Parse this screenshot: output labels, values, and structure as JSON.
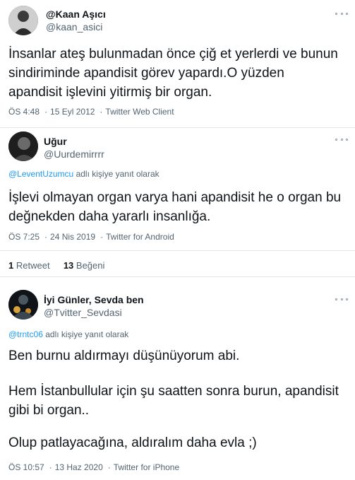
{
  "tweets": [
    {
      "name": "@Kaan Aşıcı",
      "handle": "@kaan_asici",
      "text_lines": [
        "İnsanlar ateş bulunmadan önce çiğ et yerlerdi ve bunun",
        "sindiriminde apandisit görev yapardı.O yüzden",
        "apandisit işlevini yitirmiş bir organ."
      ],
      "time": "ÖS 4:48",
      "date": "15 Eyl 2012",
      "client": "Twitter Web Client"
    },
    {
      "name": "Uğur",
      "handle": "@Uurdemirrrr",
      "reply_to": "@LeventUzumcu",
      "reply_suffix": "adlı kişiye yanıt olarak",
      "text_lines": [
        "İşlevi olmayan organ varya hani apandisit he o organ bu",
        "değnekden daha yararlı insanlığa."
      ],
      "time": "ÖS 7:25",
      "date": "24 Nis 2019",
      "client": "Twitter for Android",
      "retweets_count": "1",
      "retweets_label": "Retweet",
      "likes_count": "13",
      "likes_label": "Beğeni"
    },
    {
      "name": "İyi Günler, Sevda ben",
      "handle": "@Tvitter_Sevdasi",
      "reply_to": "@trntc06",
      "reply_suffix": "adlı kişiye yanıt olarak",
      "text_lines": [
        "Ben burnu aldırmayı düşünüyorum abi.",
        "",
        "Hem İstanbullular için şu saatten sonra burun, apandisit",
        "gibi bi organ..",
        "",
        "Olup patlayacağına, aldıralım daha evla ;)"
      ],
      "time": "ÖS 10:57",
      "date": "13 Haz 2020",
      "client": "Twitter for iPhone"
    }
  ],
  "separator": "·",
  "colors": {
    "link": "#1d9bf0",
    "muted": "#536471",
    "border": "#e1e8ed"
  },
  "icons": {
    "more": "more-options-icon"
  }
}
